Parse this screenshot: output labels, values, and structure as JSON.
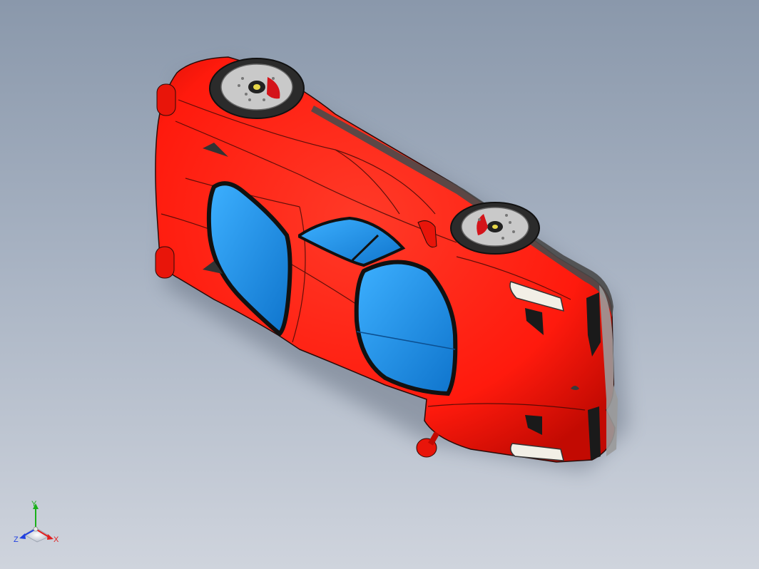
{
  "viewport": {
    "background_top": "#8a98ab",
    "background_bottom": "#cfd4dd"
  },
  "model": {
    "body_color": "#ff1a0d",
    "body_shadow_color": "#c20a02",
    "glass_color": "#1a90e8",
    "tire_color": "#2b2b2b",
    "rim_color": "#c9c9c9",
    "caliper_color": "#d4141a",
    "light_color": "#f2efe6"
  },
  "triad": {
    "x_label": "X",
    "y_label": "Y",
    "z_label": "Z",
    "x_color": "#e02020",
    "y_color": "#1ab01a",
    "z_color": "#2040e0"
  }
}
